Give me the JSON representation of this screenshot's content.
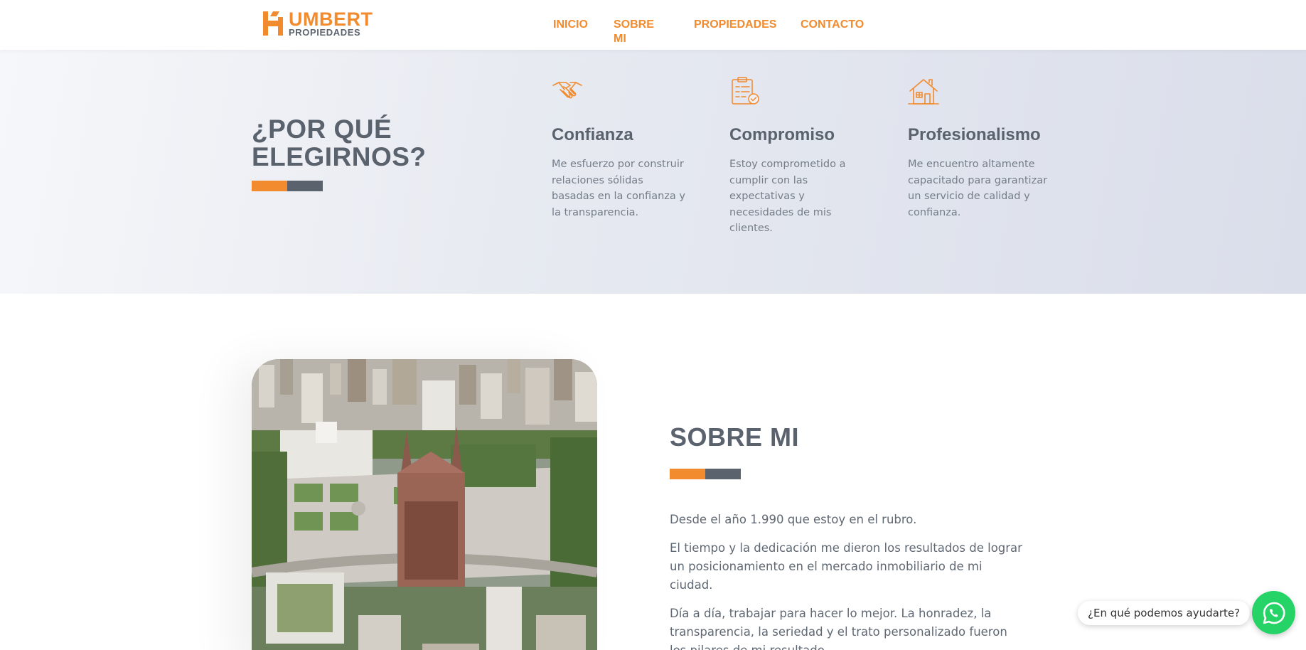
{
  "brand": {
    "name": "UMBERT",
    "sub": "PROPIEDADES",
    "accent": "#f28a2e",
    "dark": "#5a626d"
  },
  "nav": {
    "items": [
      {
        "label": "INICIO"
      },
      {
        "label": "SOBRE MI"
      },
      {
        "label": "PROPIEDADES"
      },
      {
        "label": "CONTACTO"
      }
    ]
  },
  "why": {
    "title": "¿POR QUÉ ELEGIRNOS?",
    "features": [
      {
        "icon": "handshake-icon",
        "title": "Confianza",
        "text": "Me esfuerzo por construir relaciones sólidas basadas en la confianza y la transparencia."
      },
      {
        "icon": "clipboard-check-icon",
        "title": "Compromiso",
        "text": "Estoy comprometido a cumplir con las expectativas y necesidades de mis clientes."
      },
      {
        "icon": "house-icon",
        "title": "Profesionalismo",
        "text": "Me encuentro altamente capacitado para garantizar un servicio de calidad y confianza."
      }
    ]
  },
  "about": {
    "title": "SOBRE MI",
    "paragraphs": [
      "Desde el año 1.990 que estoy en el rubro.",
      "El tiempo y la dedicación me dieron los resultados de lograr un posicionamiento en el mercado inmobiliario de mi ciudad.",
      "Día a día, trabajar para hacer lo mejor. La honradez, la transparencia, la seriedad y el trato personalizado fueron los pilares de mi resultado."
    ]
  },
  "chat": {
    "prompt": "¿En qué podemos ayudarte?",
    "icon": "whatsapp-icon",
    "color": "#25d366"
  }
}
